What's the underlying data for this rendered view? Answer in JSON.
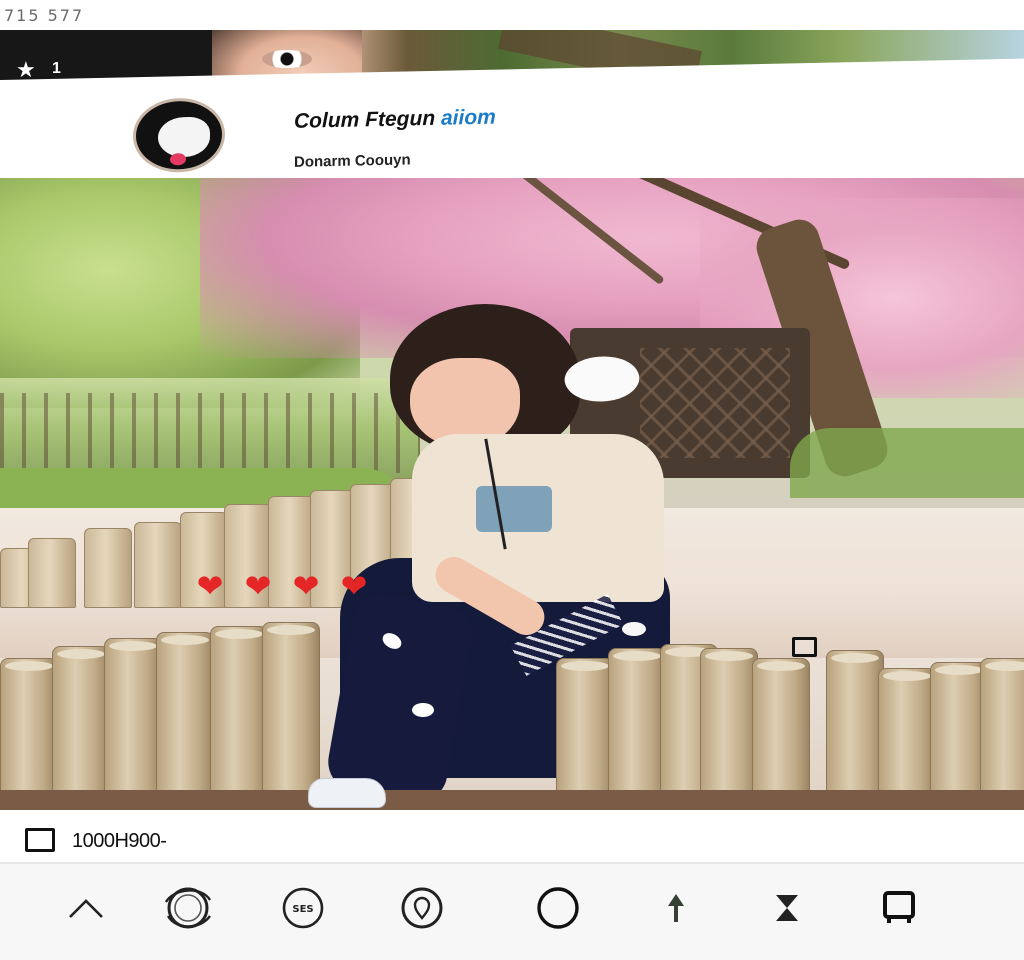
{
  "status": {
    "time": "715 577"
  },
  "header_strip": {
    "count": "1",
    "icon": "star-icon"
  },
  "profile": {
    "name_main": "Colum Ftegun",
    "name_accent": "aiiom",
    "subtitle": "Donarm Coouyn",
    "accent_color": "#1a7cc7"
  },
  "photo": {
    "hearts": [
      "❤",
      "❤",
      "❤",
      "❤"
    ],
    "heart_color": "#e52626"
  },
  "info": {
    "label": "1000H900-"
  },
  "toolbar": {
    "items": [
      {
        "name": "chevron-up-icon"
      },
      {
        "name": "circle-swirl-icon"
      },
      {
        "name": "sticker-icon",
        "label": "SES"
      },
      {
        "name": "location-pin-icon"
      },
      {
        "name": "circle-icon"
      },
      {
        "name": "arrow-up-icon"
      },
      {
        "name": "hourglass-icon"
      },
      {
        "name": "frame-icon"
      }
    ]
  }
}
